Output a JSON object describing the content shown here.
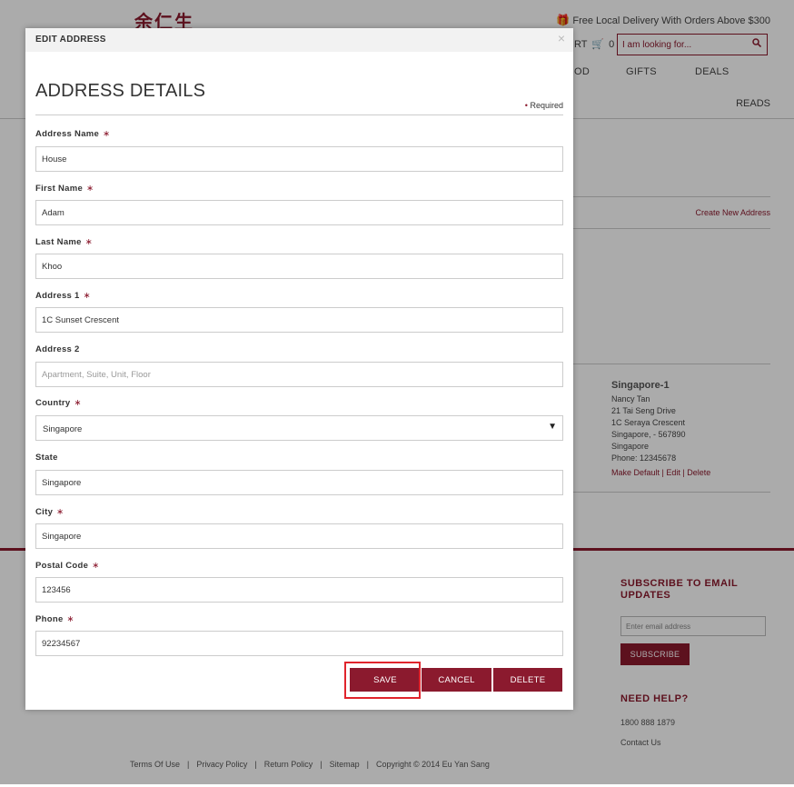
{
  "header": {
    "logo_text": "余仁生",
    "delivery_text": "Free Local Delivery With Orders Above $300",
    "cart_label": "RT",
    "cart_count": "0",
    "search_placeholder": "I am looking for...",
    "nav": [
      "OD",
      "GIFTS",
      "DEALS"
    ],
    "reads": "READS"
  },
  "account": {
    "create_new_address": "Create New Address",
    "address_card": {
      "title": "Singapore-1",
      "lines": [
        "Nancy Tan",
        "21 Tai Seng Drive",
        "1C Seraya Crescent",
        "Singapore, - 567890",
        "Singapore",
        "Phone: 12345678"
      ],
      "actions": [
        "Make Default",
        "Edit",
        "Delete"
      ]
    }
  },
  "footer": {
    "subscribe_title": "SUBSCRIBE TO EMAIL UPDATES",
    "email_placeholder": "Enter email address",
    "subscribe_button": "SUBSCRIBE",
    "help_title": "NEED HELP?",
    "help_phone": "1800 888 1879",
    "contact_us": "Contact Us",
    "links": [
      "Terms Of Use",
      "Privacy Policy",
      "Return Policy",
      "Sitemap"
    ],
    "copyright": "Copyright © 2014 Eu Yan Sang"
  },
  "modal": {
    "title": "EDIT ADDRESS",
    "close_glyph": "×",
    "heading": "ADDRESS DETAILS",
    "required_note": "Required",
    "fields": {
      "address_name": {
        "label": "Address Name",
        "value": "House",
        "required": true
      },
      "first_name": {
        "label": "First Name",
        "value": "Adam",
        "required": true
      },
      "last_name": {
        "label": "Last Name",
        "value": "Khoo",
        "required": true
      },
      "address1": {
        "label": "Address 1",
        "value": "1C Sunset Crescent",
        "required": true
      },
      "address2": {
        "label": "Address 2",
        "value": "",
        "placeholder": "Apartment, Suite, Unit, Floor",
        "required": false
      },
      "country": {
        "label": "Country",
        "value": "Singapore",
        "required": true
      },
      "state": {
        "label": "State",
        "value": "Singapore",
        "required": false
      },
      "city": {
        "label": "City",
        "value": "Singapore",
        "required": true
      },
      "postal_code": {
        "label": "Postal Code",
        "value": "123456",
        "required": true
      },
      "phone": {
        "label": "Phone",
        "value": "92234567",
        "required": true
      }
    },
    "buttons": {
      "save": "SAVE",
      "cancel": "CANCEL",
      "delete": "DELETE"
    }
  },
  "colors": {
    "brand": "#8b1a2e",
    "highlight": "#e0242c"
  }
}
